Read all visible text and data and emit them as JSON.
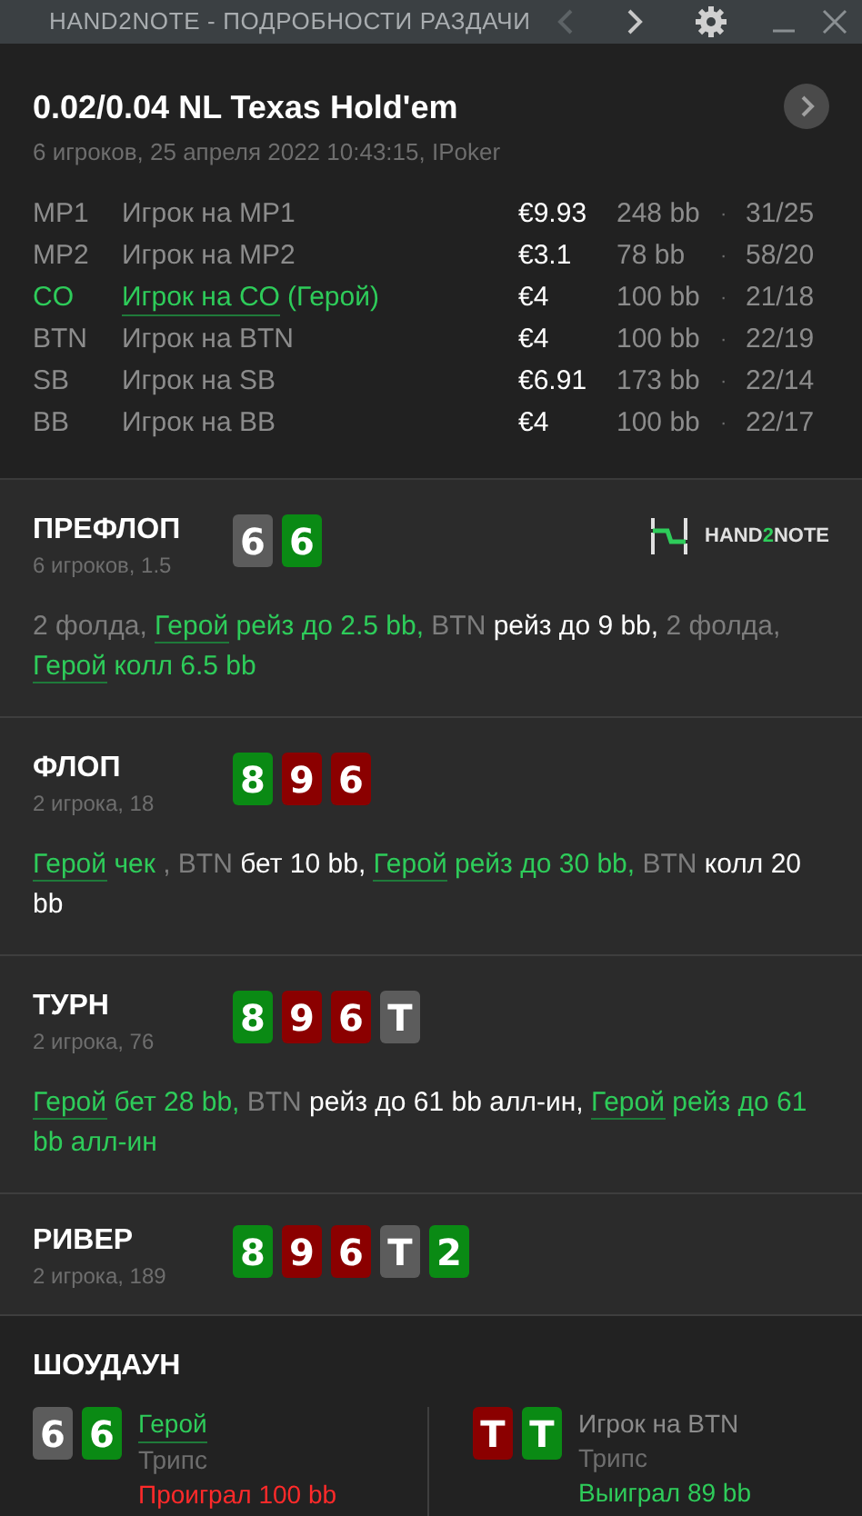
{
  "window": {
    "title": "HAND2NOTE - ПОДРОБНОСТИ РАЗДАЧИ"
  },
  "hand": {
    "title": "0.02/0.04 NL Texas Hold'em",
    "subtitle": "6 игроков, 25 апреля 2022 10:43:15, IPoker"
  },
  "players": [
    {
      "position": "MP1",
      "name": "Игрок на MP1",
      "hero": false,
      "stack": "€9.93",
      "bb": "248 bb",
      "sep": "·",
      "stats": "31/25"
    },
    {
      "position": "MP2",
      "name": "Игрок на MP2",
      "hero": false,
      "stack": "€3.1",
      "bb": "78 bb",
      "sep": "·",
      "stats": "58/20"
    },
    {
      "position": "CO",
      "name": "Игрок на CO",
      "suffix": "(Герой)",
      "hero": true,
      "stack": "€4",
      "bb": "100 bb",
      "sep": "·",
      "stats": "21/18"
    },
    {
      "position": "BTN",
      "name": "Игрок на BTN",
      "hero": false,
      "stack": "€4",
      "bb": "100 bb",
      "sep": "·",
      "stats": "22/19"
    },
    {
      "position": "SB",
      "name": "Игрок на SB",
      "hero": false,
      "stack": "€6.91",
      "bb": "173 bb",
      "sep": "·",
      "stats": "22/14"
    },
    {
      "position": "BB",
      "name": "Игрок на BB",
      "hero": false,
      "stack": "€4",
      "bb": "100 bb",
      "sep": "·",
      "stats": "22/17"
    }
  ],
  "streets": [
    {
      "name": "ПРЕФЛОП",
      "info": "6 игроков, 1.5",
      "logo": {
        "text_a": "HAND",
        "text_b": "2",
        "text_c": "NOTE"
      },
      "cards": [
        {
          "rank": "6",
          "color": "#5c5c5c"
        },
        {
          "rank": "6",
          "color": "#0a8a14"
        }
      ],
      "actions": [
        {
          "kind": "muted",
          "text": "2 фолда, "
        },
        {
          "kind": "hero_link",
          "text": "Герой"
        },
        {
          "kind": "hero",
          "text": " рейз до 2.5 bb, "
        },
        {
          "kind": "muted",
          "text": "BTN "
        },
        {
          "kind": "bet",
          "text": "рейз до 9 bb, "
        },
        {
          "kind": "muted",
          "text": "2 фолда, "
        },
        {
          "kind": "hero_link",
          "text": "Герой"
        },
        {
          "kind": "hero",
          "text": " колл 6.5 bb"
        }
      ]
    },
    {
      "name": "ФЛОП",
      "info": "2 игрока, 18",
      "cards": [
        {
          "rank": "8",
          "color": "#0a8a14"
        },
        {
          "rank": "9",
          "color": "#8b0000"
        },
        {
          "rank": "6",
          "color": "#8b0000"
        }
      ],
      "actions": [
        {
          "kind": "hero_link",
          "text": "Герой"
        },
        {
          "kind": "hero",
          "text": " чек "
        },
        {
          "kind": "muted",
          "text": ", BTN "
        },
        {
          "kind": "bet",
          "text": "бет 10 bb, "
        },
        {
          "kind": "hero_link",
          "text": "Герой"
        },
        {
          "kind": "hero",
          "text": " рейз до 30 bb, "
        },
        {
          "kind": "muted",
          "text": "BTN "
        },
        {
          "kind": "bet",
          "text": "колл 20 bb"
        }
      ]
    },
    {
      "name": "ТУРН",
      "info": "2 игрока, 76",
      "cards": [
        {
          "rank": "8",
          "color": "#0a8a14"
        },
        {
          "rank": "9",
          "color": "#8b0000"
        },
        {
          "rank": "6",
          "color": "#8b0000"
        },
        {
          "rank": "T",
          "color": "#5c5c5c"
        }
      ],
      "actions": [
        {
          "kind": "hero_link",
          "text": "Герой"
        },
        {
          "kind": "hero",
          "text": " бет 28 bb, "
        },
        {
          "kind": "muted",
          "text": "BTN "
        },
        {
          "kind": "bet",
          "text": "рейз до 61 bb алл-ин, "
        },
        {
          "kind": "hero_link",
          "text": "Герой"
        },
        {
          "kind": "hero",
          "text": " рейз до 61 bb алл-ин"
        }
      ]
    },
    {
      "name": "РИВЕР",
      "info": "2 игрока, 189",
      "cards": [
        {
          "rank": "8",
          "color": "#0a8a14"
        },
        {
          "rank": "9",
          "color": "#8b0000"
        },
        {
          "rank": "6",
          "color": "#8b0000"
        },
        {
          "rank": "T",
          "color": "#5c5c5c"
        },
        {
          "rank": "2",
          "color": "#0a8a14"
        }
      ]
    }
  ],
  "showdown": {
    "title": "ШОУДАУН",
    "players": [
      {
        "name": "Герой",
        "hero": true,
        "hand": "Трипс",
        "result": "Проиграл 100 bb",
        "won": false,
        "cards": [
          {
            "rank": "6",
            "color": "#5c5c5c"
          },
          {
            "rank": "6",
            "color": "#0a8a14"
          }
        ]
      },
      {
        "name": "Игрок на BTN",
        "hero": false,
        "hand": "Трипс",
        "result": "Выиграл 89 bb",
        "won": true,
        "cards": [
          {
            "rank": "T",
            "color": "#8b0000"
          },
          {
            "rank": "T",
            "color": "#0a8a14"
          }
        ]
      }
    ]
  }
}
